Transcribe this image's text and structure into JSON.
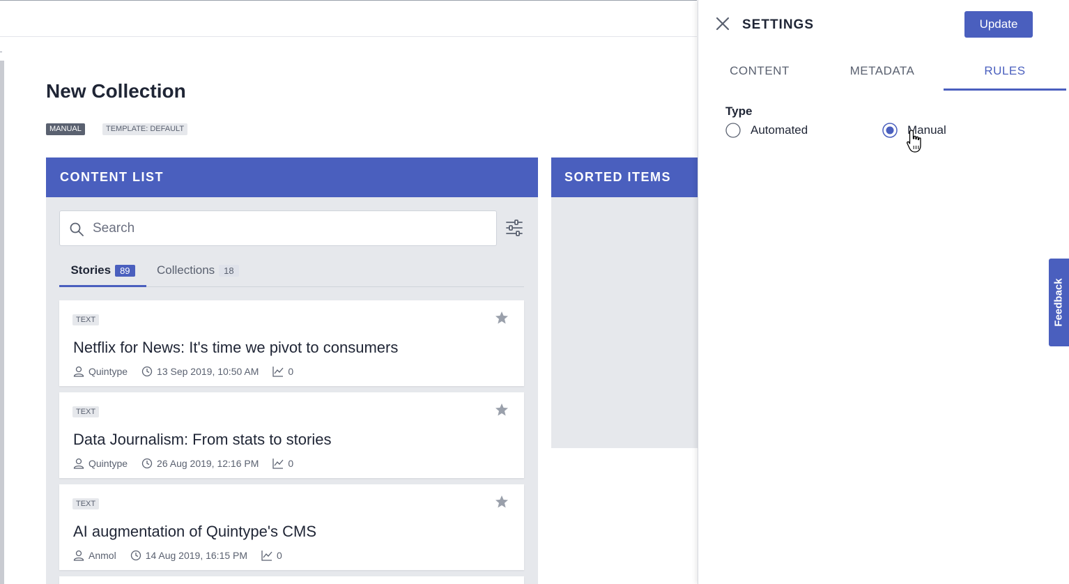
{
  "collection": {
    "title": "New Collection",
    "badges": {
      "type": "MANUAL",
      "template": "TEMPLATE: DEFAULT"
    }
  },
  "content_list": {
    "header": "CONTENT LIST",
    "search": {
      "placeholder": "Search",
      "value": ""
    },
    "tabs": [
      {
        "label": "Stories",
        "count": "89",
        "active": true
      },
      {
        "label": "Collections",
        "count": "18",
        "active": false
      }
    ],
    "stories": [
      {
        "type": "TEXT",
        "title": "Netflix for News: It's time we pivot to consumers",
        "author": "Quintype",
        "date": "13 Sep 2019, 10:50 AM",
        "views": "0"
      },
      {
        "type": "TEXT",
        "title": "Data Journalism: From stats to stories",
        "author": "Quintype",
        "date": "26 Aug 2019, 12:16 PM",
        "views": "0"
      },
      {
        "type": "TEXT",
        "title": "AI augmentation of Quintype's CMS",
        "author": "Anmol",
        "date": "14 Aug 2019, 16:15 PM",
        "views": "0"
      }
    ]
  },
  "sorted_items": {
    "header": "SORTED ITEMS"
  },
  "settings": {
    "title": "SETTINGS",
    "update_label": "Update",
    "tabs": [
      {
        "label": "CONTENT",
        "active": false
      },
      {
        "label": "METADATA",
        "active": false
      },
      {
        "label": "RULES",
        "active": true
      }
    ],
    "type_label": "Type",
    "type_options": [
      {
        "label": "Automated",
        "selected": false
      },
      {
        "label": "Manual",
        "selected": true
      }
    ]
  },
  "feedback": {
    "label": "Feedback"
  },
  "colors": {
    "accent": "#4a5fbe",
    "panel_bg": "#e6e8ec",
    "text": "#1f2535",
    "muted": "#5a6170"
  },
  "icons": [
    "search-icon",
    "filter-icon",
    "star-icon",
    "user-icon",
    "clock-icon",
    "chart-icon",
    "close-icon",
    "cursor-hand-icon"
  ]
}
